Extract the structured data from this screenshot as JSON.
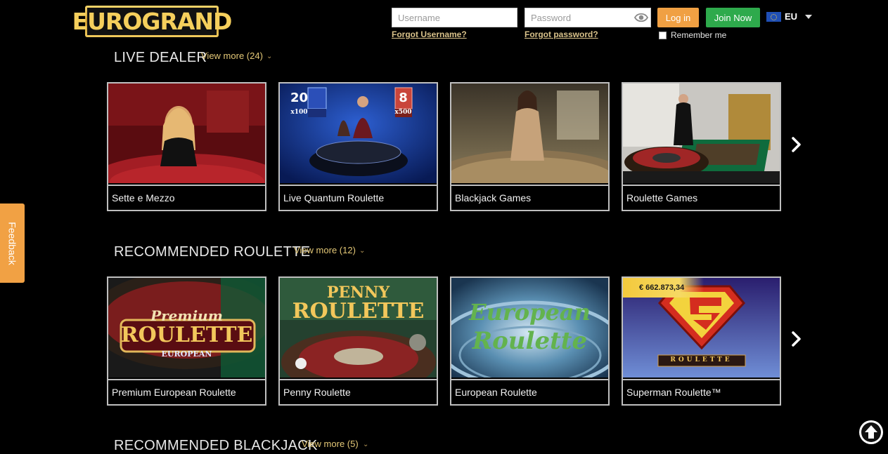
{
  "header": {
    "logo_text": "EUROGRAND",
    "username_placeholder": "Username",
    "password_placeholder": "Password",
    "forgot_username": "Forgot Username?",
    "forgot_password": "Forgot password?",
    "login_label": "Log in",
    "join_label": "Join Now",
    "remember_label": "Remember me",
    "region": "EU"
  },
  "sections": [
    {
      "title": "LIVE DEALER",
      "view_more": "View more (24)",
      "games": [
        {
          "name": "Sette e Mezzo"
        },
        {
          "name": "Live Quantum Roulette",
          "art": [
            "20",
            "x100",
            "8",
            "x500"
          ]
        },
        {
          "name": "Blackjack Games"
        },
        {
          "name": "Roulette Games"
        }
      ]
    },
    {
      "title": "RECOMMENDED ROULETTE",
      "view_more": "View more (12)",
      "games": [
        {
          "name": "Premium European Roulette",
          "art": [
            "Premium",
            "ROULETTE",
            "EUROPEAN"
          ]
        },
        {
          "name": "Penny Roulette",
          "art": [
            "PENNY",
            "ROULETTE"
          ]
        },
        {
          "name": "European Roulette",
          "art": [
            "European",
            "Roulette"
          ]
        },
        {
          "name": "Superman Roulette™",
          "jackpot": "€ 662.873,34",
          "art": [
            "ROULETTE"
          ]
        }
      ]
    },
    {
      "title": "RECOMMENDED BLACKJACK",
      "view_more": "View more (5)"
    }
  ],
  "feedback_label": "Feedback",
  "colors": {
    "background": "#000000",
    "accent_gold": "#e4c877",
    "login_orange": "#f0a043",
    "join_green": "#2eaa4c",
    "card_border": "#bfbfbf"
  },
  "icons": [
    "eye-icon",
    "chevron-down-icon",
    "chevron-right-icon",
    "arrow-up-circle-icon",
    "eu-flag-icon"
  ]
}
